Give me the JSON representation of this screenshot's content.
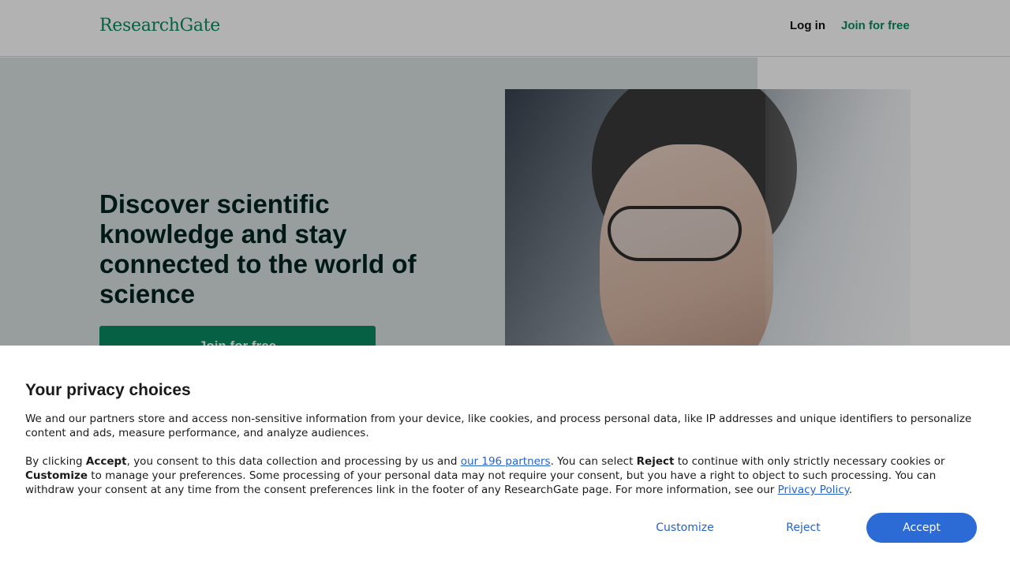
{
  "header": {
    "logo": "ResearchGate",
    "login_label": "Log in",
    "join_label": "Join for free"
  },
  "hero": {
    "title": "Discover scientific knowledge and stay connected to the world of science",
    "cta_label": "Join for free"
  },
  "consent": {
    "title": "Your privacy choices",
    "p1": "We and our partners store and access non-sensitive information from your device, like cookies, and process personal data, like IP addresses and unique identifiers to personalize content and ads, measure performance, and analyze audiences.",
    "p2_1": "By clicking ",
    "p2_accept": "Accept",
    "p2_2": ", you consent to this data collection and processing by us and ",
    "p2_partners_link": "our 196 partners",
    "p2_3": ". You can select ",
    "p2_reject": "Reject",
    "p2_4": " to continue with only strictly necessary cookies or ",
    "p2_customize": "Customize",
    "p2_5": " to manage your preferences. Some processing of your personal data may not require your consent, but you have a right to object to such processing. You can withdraw your consent at any time from the consent preferences link in the footer of any ResearchGate page. For more information, see our ",
    "p2_privacy_link": "Privacy Policy",
    "p2_6": ".",
    "customize_label": "Customize",
    "reject_label": "Reject",
    "accept_label": "Accept"
  },
  "colors": {
    "brand_green": "#0a8a62",
    "link_blue": "#2563c9",
    "accept_blue": "#2c6bd6",
    "hero_bg": "#d8e2e1"
  }
}
